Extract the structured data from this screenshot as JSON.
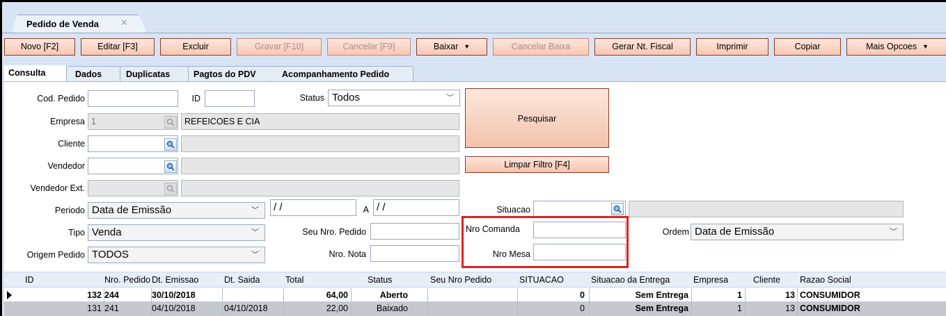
{
  "window_tab": {
    "title": "Pedido de Venda",
    "close": "✕"
  },
  "toolbar": {
    "novo": "Novo [F2]",
    "editar": "Editar [F3]",
    "excluir": "Excluir",
    "gravar": "Gravar [F10]",
    "cancelar": "Cancelar [F9]",
    "baixar": "Baixar",
    "cancelar_baixa": "Cancelar Baixa",
    "gerar_nf": "Gerar Nt. Fiscal",
    "imprimir": "Imprimir",
    "copiar": "Copiar",
    "mais_opcoes": "Mais Opcoes"
  },
  "tabs": [
    "Consulta",
    "Dados",
    "Duplicatas",
    "Pagtos do PDV",
    "Acompanhamento Pedido"
  ],
  "form": {
    "cod_pedido_label": "Cod. Pedido",
    "cod_pedido_value": "",
    "id_label": "ID",
    "id_value": "",
    "status_label": "Status",
    "status_value": "Todos",
    "empresa_label": "Empresa",
    "empresa_code": "1",
    "empresa_name": "REFEICOES E CIA",
    "cliente_label": "Cliente",
    "vendedor_label": "Vendedor",
    "vendedor_ext_label": "Vendedor Ext.",
    "periodo_label": "Periodo",
    "periodo_value": "Data de Emissão",
    "date_from": "/ /",
    "a_label": "A",
    "date_to": "/ /",
    "situacao_label": "Situacao",
    "tipo_label": "Tipo",
    "tipo_value": "Venda",
    "seu_nro_pedido_label": "Seu Nro. Pedido",
    "nro_comanda_label": "Nro Comanda",
    "ordem_label": "Ordem",
    "ordem_value": "Data de Emissão",
    "origem_label": "Origem Pedido",
    "origem_value": "TODOS",
    "nro_nota_label": "Nro. Nota",
    "nro_mesa_label": "Nro Mesa",
    "pesquisar": "Pesquisar",
    "limpar": "Limpar Filtro [F4]"
  },
  "grid": {
    "columns": [
      "ID",
      "Nro. Pedido",
      "Dt. Emissao",
      "Dt. Saida",
      "Total",
      "Status",
      "Seu Nro Pedido",
      "SITUACAO",
      "Situacao da Entrega",
      "Empresa",
      "Cliente",
      "Razao Social"
    ],
    "rows": [
      [
        "132",
        "244",
        "30/10/2018",
        "",
        "64,00",
        "Aberto",
        "",
        "0",
        "Sem Entrega",
        "1",
        "13",
        "CONSUMIDOR"
      ],
      [
        "131",
        "241",
        "04/10/2018",
        "04/10/2018",
        "22,00",
        "Baixado",
        "",
        "0",
        "Sem Entrega",
        "1",
        "13",
        "CONSUMIDOR"
      ]
    ]
  },
  "colors": {
    "accent_red": "#e02020",
    "button_fill": "#f7c7b2",
    "background": "#d8e4f3"
  }
}
